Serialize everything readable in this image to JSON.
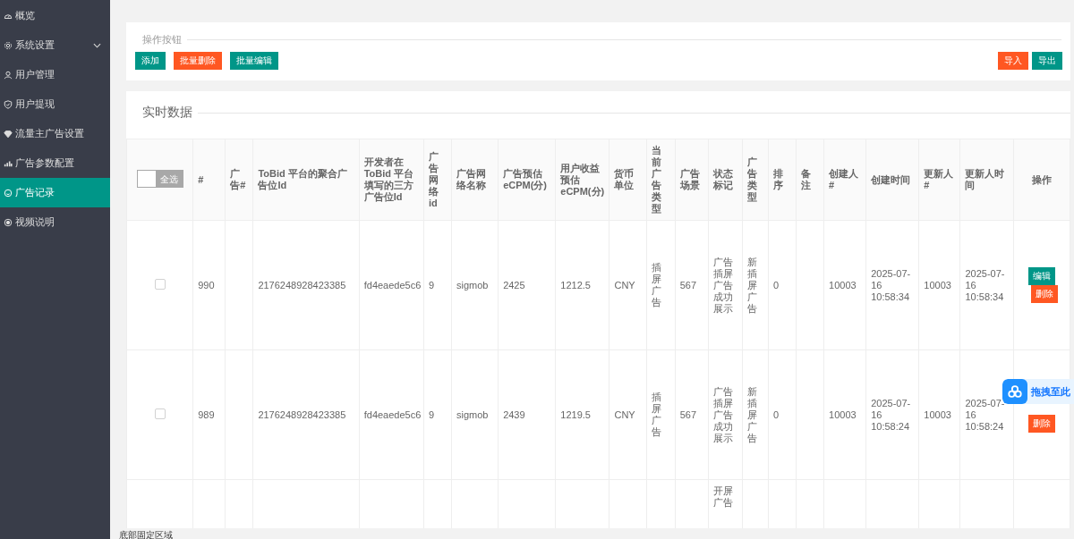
{
  "sidebar": {
    "items": [
      {
        "label": "概览",
        "selected": false
      },
      {
        "label": "系统设置",
        "selected": false,
        "expanded": false
      },
      {
        "label": "用户管理",
        "selected": false
      },
      {
        "label": "用户提现",
        "selected": false
      },
      {
        "label": "流量主广告设置",
        "selected": false
      },
      {
        "label": "广告参数配置",
        "selected": false
      },
      {
        "label": "广告记录",
        "selected": true
      },
      {
        "label": "视频说明",
        "selected": false
      }
    ]
  },
  "actions_panel": {
    "legend": "操作按钮",
    "left_buttons": [
      {
        "label": "添加",
        "kind": "primary"
      },
      {
        "label": "批量删除",
        "kind": "danger"
      },
      {
        "label": "批量编辑",
        "kind": "primary"
      }
    ],
    "right_buttons": [
      {
        "label": "导入",
        "kind": "danger"
      },
      {
        "label": "导出",
        "kind": "primary"
      }
    ]
  },
  "data_panel": {
    "legend": "实时数据",
    "table": {
      "select_all": {
        "label": "全选",
        "on": false
      },
      "columns": [
        "#",
        "广告#",
        "ToBid 平台的聚合广告位Id",
        "开发者在ToBid 平台填写的三方广告位Id",
        "广告网络id",
        "广告网络名称",
        "广告预估eCPM(分)",
        "用户收益预估eCPM(分)",
        "货币单位",
        "当前广告类型",
        "广告场景",
        "状态标记",
        "广告类型",
        "排序",
        "备注",
        "创建人#",
        "创建时间",
        "更新人#",
        "更新人时间",
        "操作"
      ],
      "rows": [
        {
          "checked": false,
          "cells": [
            "990",
            null,
            "2176248928423385",
            "fd4eaede5c6",
            "9",
            "sigmob",
            "2425",
            "1212.5",
            "CNY",
            "插屏广告",
            "567",
            "广告插屏广告成功展示",
            "新插屏广告",
            "0",
            null,
            "10003",
            "2025-07-16 10:58:34",
            "10003",
            "2025-07-16 10:58:34"
          ],
          "actions": [
            {
              "label": "编辑",
              "kind": "primary"
            },
            {
              "label": "删除",
              "kind": "danger"
            }
          ]
        },
        {
          "checked": false,
          "cells": [
            "989",
            null,
            "2176248928423385",
            "fd4eaede5c6",
            "9",
            "sigmob",
            "2439",
            "1219.5",
            "CNY",
            "插屏广告",
            "567",
            "广告插屏广告成功展示",
            "新插屏广告",
            "0",
            null,
            "10003",
            "2025-07-16 10:58:24",
            "10003",
            "2025-07-16 10:58:24"
          ],
          "actions": [
            {
              "label": "删除",
              "kind": "danger"
            }
          ]
        },
        {
          "cells": [
            null,
            null,
            null,
            null,
            null,
            null,
            null,
            null,
            null,
            null,
            null,
            "开屏广告",
            null,
            null,
            null,
            null,
            null,
            null,
            null
          ],
          "actions": []
        }
      ]
    }
  },
  "drop_widget": {
    "label": "拖拽至此"
  },
  "footer": {
    "text": "底部固定区域"
  }
}
